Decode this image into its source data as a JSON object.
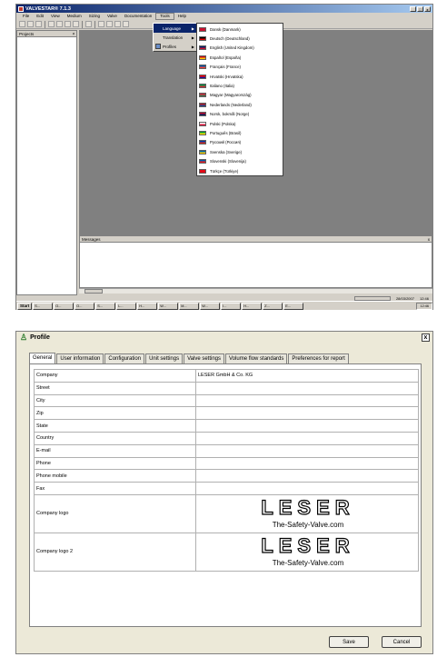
{
  "app": {
    "title": "VALVESTAR® 7.1.3",
    "win_buttons": [
      "_",
      "□",
      "x"
    ],
    "menus": [
      "File",
      "Edit",
      "View",
      "Medium",
      "Sizing",
      "Valve",
      "Documentation",
      "Tools",
      "Help"
    ],
    "tools_menu": [
      {
        "label": "Language",
        "icon": "none"
      },
      {
        "label": "Translation",
        "icon": "none"
      },
      {
        "label": "Profiles",
        "icon": "profile-icon"
      }
    ],
    "languages": [
      {
        "label": "Dansk (Danmark)",
        "flag": [
          "#c8102e",
          "#c8102e"
        ]
      },
      {
        "label": "Deutsch (Deutschland)",
        "flag": [
          "#000000",
          "#dd0000"
        ]
      },
      {
        "label": "English (United Kingdom)",
        "flag": [
          "#012169",
          "#c8102e"
        ]
      },
      {
        "label": "Español (España)",
        "flag": [
          "#c60b1e",
          "#ffc400"
        ]
      },
      {
        "label": "Français (France)",
        "flag": [
          "#0055a4",
          "#ef4135"
        ]
      },
      {
        "label": "Hrvatski (Hrvatska)",
        "flag": [
          "#ff0000",
          "#171796"
        ]
      },
      {
        "label": "Italiano (Italia)",
        "flag": [
          "#009246",
          "#ce2b37"
        ]
      },
      {
        "label": "Magyar (Magyarország)",
        "flag": [
          "#cd2a3e",
          "#436f4d"
        ]
      },
      {
        "label": "Nederlands (Nederland)",
        "flag": [
          "#ae1c28",
          "#21468b"
        ]
      },
      {
        "label": "Norsk, bokmål (Norge)",
        "flag": [
          "#ba0c2f",
          "#00205b"
        ]
      },
      {
        "label": "Polski (Polska)",
        "flag": [
          "#ffffff",
          "#dc143c"
        ]
      },
      {
        "label": "Português (Brasil)",
        "flag": [
          "#009c3b",
          "#ffdf00"
        ]
      },
      {
        "label": "Русский (Россия)",
        "flag": [
          "#0039a6",
          "#d52b1e"
        ]
      },
      {
        "label": "Svenska (Sverige)",
        "flag": [
          "#006aa7",
          "#fecc00"
        ]
      },
      {
        "label": "Slovenski (Slovenija)",
        "flag": [
          "#005da4",
          "#ed1c24"
        ]
      },
      {
        "label": "Türkçe (Türkiye)",
        "flag": [
          "#e30a17",
          "#e30a17"
        ]
      }
    ],
    "projects_label": "Projects",
    "projects_pin": "ᵠ",
    "messages_label": "Messages",
    "messages_close": "x",
    "status_date": "28/03/2007",
    "status_time": "12:46",
    "start_label": "Start",
    "tasks": [
      "S...",
      "O...",
      "O...",
      "S...",
      "L...",
      "H...",
      "W...",
      "M...",
      "W...",
      "I...",
      "H...",
      "Z...",
      "E..."
    ],
    "tray": "12:46"
  },
  "dialog": {
    "title": "Profile",
    "close": "x",
    "tabs": [
      "General",
      "User information",
      "Configuration",
      "Unit settings",
      "Valve settings",
      "Volume flow standards",
      "Preferences for report"
    ],
    "rows": [
      {
        "label": "Company",
        "value": "LESER GmbH & Co. KG"
      },
      {
        "label": "Street",
        "value": ""
      },
      {
        "label": "City",
        "value": ""
      },
      {
        "label": "Zip",
        "value": ""
      },
      {
        "label": "State",
        "value": ""
      },
      {
        "label": "Country",
        "value": ""
      },
      {
        "label": "E-mail",
        "value": ""
      },
      {
        "label": "Phone",
        "value": ""
      },
      {
        "label": "Phone mobile",
        "value": ""
      },
      {
        "label": "Fax",
        "value": ""
      }
    ],
    "logo_rows": [
      {
        "label": "Company logo",
        "mark": "LESER",
        "tagline": "The-Safety-Valve.com"
      },
      {
        "label": "Company logo 2",
        "mark": "LESER",
        "tagline": "The-Safety-Valve.com"
      }
    ],
    "save_label": "Save",
    "cancel_label": "Cancel"
  }
}
